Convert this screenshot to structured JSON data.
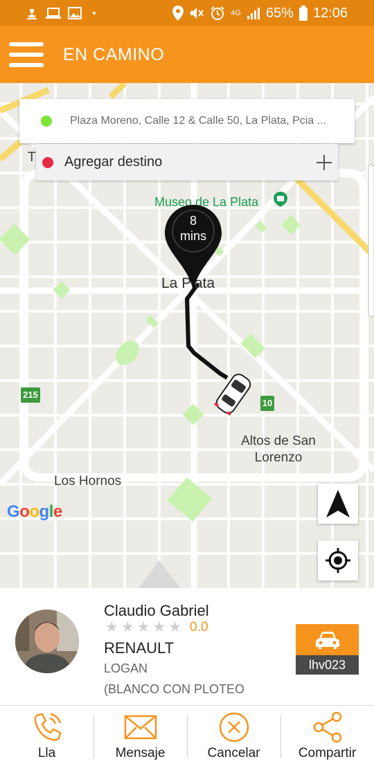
{
  "status_bar": {
    "network": "4G",
    "battery": "65%",
    "time": "12:06"
  },
  "header": {
    "title": "EN CAMINO"
  },
  "origin": {
    "address": "Plaza Moreno, Calle 12 & Calle 50, La Plata, Pcia ..."
  },
  "destination": {
    "placeholder": "Agregar destino"
  },
  "eta": {
    "value": "8",
    "unit": "mins"
  },
  "map": {
    "labels": {
      "museum": "Museo de La Plata",
      "city": "La Plata",
      "altos": "Altos de San Lorenzo",
      "hornos": "Los Hornos",
      "t": "T"
    },
    "routes": [
      "215",
      "10"
    ],
    "google": [
      "G",
      "o",
      "o",
      "g",
      "l",
      "e"
    ]
  },
  "driver": {
    "name": "Claudio Gabriel",
    "rating": "0.0",
    "stars_filled": 0,
    "stars_total": 5,
    "car_brand": "RENAULT",
    "car_model": "LOGAN",
    "car_color": "(BLANCO CON PLOTEO",
    "plate": "lhv023"
  },
  "actions": {
    "call": "Lla",
    "message": "Mensaje",
    "cancel": "Cancelar",
    "share": "Compartir"
  },
  "colors": {
    "status_bar": "#e3850f",
    "header": "#f7941d",
    "accent": "#f7941d",
    "origin_dot": "#7ee43a",
    "destination_dot": "#e62a45",
    "map_background": "#ecebe6",
    "park": "#c9f2b0"
  }
}
